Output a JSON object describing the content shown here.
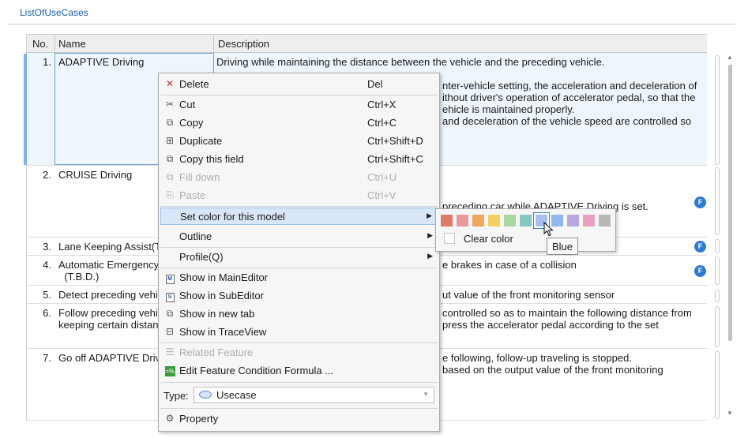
{
  "page": {
    "title": "ListOfUseCases"
  },
  "table": {
    "headers": {
      "no": "No.",
      "name": "Name",
      "description": "Description"
    },
    "rows": [
      {
        "no": "1.",
        "name": "ADAPTIVE Driving",
        "description_lines": [
          "Driving while maintaining the distance between the vehicle and the preceding vehicle.",
          "",
          "nter-vehicle setting, the acceleration and deceleration of",
          "ithout driver's operation of accelerator pedal, so that the",
          "ehicle is maintained properly.",
          " and deceleration of the vehicle speed are controlled so"
        ]
      },
      {
        "no": "2.",
        "name": "CRUISE Driving",
        "description_lines": [
          "",
          "",
          "",
          "preceding car while ADAPTIVE Driving is set."
        ]
      },
      {
        "no": "3.",
        "name": "Lane Keeping Assist(T",
        "description_lines": [
          ""
        ]
      },
      {
        "no": "4.",
        "name": "Automatic Emergency\n  (T.B.D.)",
        "description_lines": [
          "e brakes in case of a collision"
        ]
      },
      {
        "no": "5.",
        "name": "Detect preceding vehi",
        "description_lines": [
          "ut value of the front monitoring sensor"
        ]
      },
      {
        "no": "6.",
        "name": "Follow preceding vehi\nkeeping certain distan",
        "description_lines": [
          " controlled so as to maintain the following distance from",
          " press the accelerator pedal according to the set"
        ]
      },
      {
        "no": "7.",
        "name": "Go off ADAPTIVE Drivi",
        "description_lines": [
          "e following, follow-up traveling is stopped.",
          " based on the output value of the front monitoring"
        ]
      }
    ],
    "feature_badge": "F"
  },
  "context_menu": {
    "items": [
      {
        "label": "Delete",
        "shortcut": "Del",
        "icon": "delete-x-icon"
      },
      {
        "label": "Cut",
        "shortcut": "Ctrl+X",
        "icon": "scissors-icon"
      },
      {
        "label": "Copy",
        "shortcut": "Ctrl+C",
        "icon": "copy-icon"
      },
      {
        "label": "Duplicate",
        "shortcut": "Ctrl+Shift+D",
        "icon": "duplicate-icon"
      },
      {
        "label": "Copy this field",
        "shortcut": "Ctrl+Shift+C",
        "icon": "copy-field-icon"
      },
      {
        "label": "Fill down",
        "shortcut": "Ctrl+U",
        "icon": "fill-down-icon",
        "disabled": true
      },
      {
        "label": "Paste",
        "shortcut": "Ctrl+V",
        "icon": "paste-icon",
        "disabled": true
      },
      {
        "label": "Set color for this model",
        "submenu": true
      },
      {
        "label": "Outline",
        "submenu": true
      },
      {
        "label": "Profile(Q)",
        "submenu": true
      },
      {
        "label": "Show in MainEditor",
        "icon": "main-editor-icon",
        "icon_text": "M"
      },
      {
        "label": "Show in SubEditor",
        "icon": "sub-editor-icon",
        "icon_text": "S"
      },
      {
        "label": "Show in new tab",
        "icon": "new-tab-icon"
      },
      {
        "label": "Show in TraceView",
        "icon": "trace-view-icon"
      },
      {
        "label": "Related Feature",
        "icon": "related-feature-icon",
        "disabled": true
      },
      {
        "label": "Edit Feature Condition Formula ...",
        "icon": "formula-icon",
        "icon_text": "=%"
      },
      {
        "label": "Property",
        "icon": "property-icon"
      }
    ],
    "type_label": "Type:",
    "type_value": "Usecase"
  },
  "color_submenu": {
    "colors": [
      "#e07a6a",
      "#e89a9a",
      "#f0a860",
      "#f2d060",
      "#a8d8a0",
      "#88c8c0",
      "#a8c0f0",
      "#90b8ec",
      "#b8a8e0",
      "#e8a0c0",
      "#b8b8b8"
    ],
    "selected_index": 6,
    "clear_label": "Clear color",
    "tooltip": "Blue"
  }
}
